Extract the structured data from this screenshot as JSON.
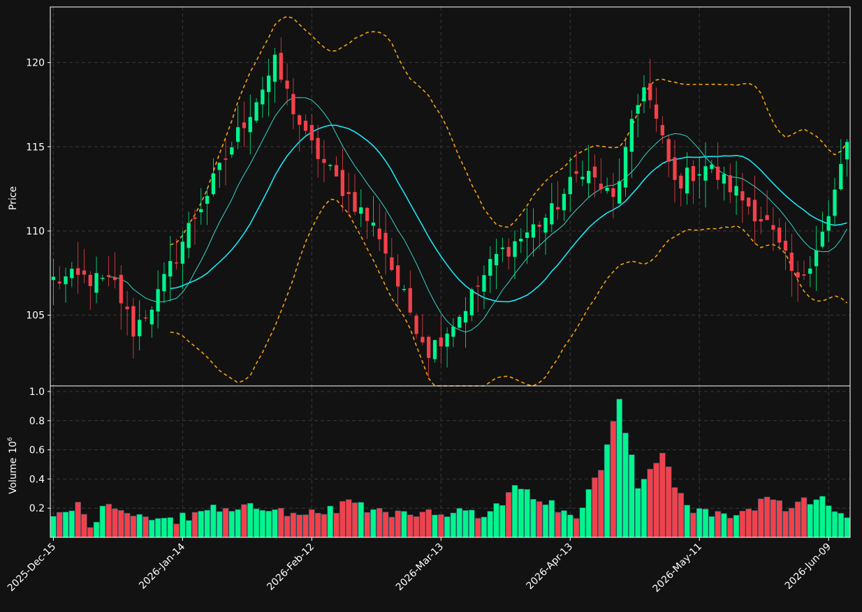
{
  "chart_data": {
    "type": "candlestick",
    "price_panel": {
      "ylabel": "Price",
      "ylim": [
        100.8,
        123.3
      ],
      "yticks": [
        105,
        110,
        115,
        120
      ],
      "grid": true
    },
    "volume_panel": {
      "ylabel": "Volume",
      "ylabel_exponent": "10",
      "ylabel_exponent_power": "6",
      "ylim": [
        0,
        1.0
      ],
      "yticks": [
        "0.2",
        "0.4",
        "0.6",
        "0.8",
        "1.0"
      ],
      "grid": true
    },
    "xlim": [
      -0.5,
      129.5
    ],
    "x_ticks": [
      {
        "label": "2025-Dec-15",
        "index": 0
      },
      {
        "label": "2026-Jan-14",
        "index": 21
      },
      {
        "label": "2026-Feb-12",
        "index": 42
      },
      {
        "label": "2026-Mar-13",
        "index": 63
      },
      {
        "label": "2026-Apr-13",
        "index": 84
      },
      {
        "label": "2026-May-11",
        "index": 105
      },
      {
        "label": "2026-Jun-09",
        "index": 126
      }
    ],
    "colors": {
      "up": "#00f58c",
      "down": "#f2414a",
      "ma_slow": "#19e7f5",
      "ma_fast": "#38d6c8",
      "bollinger": "#f5a20f",
      "background": "#121212",
      "grid": "#3a3a3a"
    },
    "close_anchors": [
      [
        0,
        107.1
      ],
      [
        5,
        107.2
      ],
      [
        10,
        106.8
      ],
      [
        13,
        104.1
      ],
      [
        17,
        106.2
      ],
      [
        22,
        110.2
      ],
      [
        27,
        113.6
      ],
      [
        31,
        116.5
      ],
      [
        36,
        119.9
      ],
      [
        41,
        115.5
      ],
      [
        46,
        113.0
      ],
      [
        53,
        109.8
      ],
      [
        56,
        106.8
      ],
      [
        61,
        102.9
      ],
      [
        66,
        105.0
      ],
      [
        72,
        108.5
      ],
      [
        76,
        109.6
      ],
      [
        81,
        111.1
      ],
      [
        86,
        113.8
      ],
      [
        91,
        111.8
      ],
      [
        96,
        118.9
      ],
      [
        101,
        112.8
      ],
      [
        106,
        113.9
      ],
      [
        111,
        112.3
      ],
      [
        116,
        110.4
      ],
      [
        121,
        106.8
      ],
      [
        126,
        110.7
      ],
      [
        129,
        115.3
      ]
    ],
    "volume_anchors": [
      [
        0,
        0.13
      ],
      [
        4,
        0.24
      ],
      [
        6,
        0.08
      ],
      [
        9,
        0.25
      ],
      [
        15,
        0.12
      ],
      [
        21,
        0.13
      ],
      [
        26,
        0.19
      ],
      [
        34,
        0.22
      ],
      [
        40,
        0.13
      ],
      [
        48,
        0.22
      ],
      [
        56,
        0.17
      ],
      [
        64,
        0.18
      ],
      [
        70,
        0.14
      ],
      [
        75,
        0.32
      ],
      [
        80,
        0.25
      ],
      [
        85,
        0.11
      ],
      [
        89,
        0.5
      ],
      [
        92,
        0.94
      ],
      [
        95,
        0.37
      ],
      [
        99,
        0.55
      ],
      [
        103,
        0.19
      ],
      [
        110,
        0.15
      ],
      [
        116,
        0.24
      ],
      [
        120,
        0.19
      ],
      [
        125,
        0.3
      ],
      [
        129,
        0.1
      ]
    ]
  }
}
